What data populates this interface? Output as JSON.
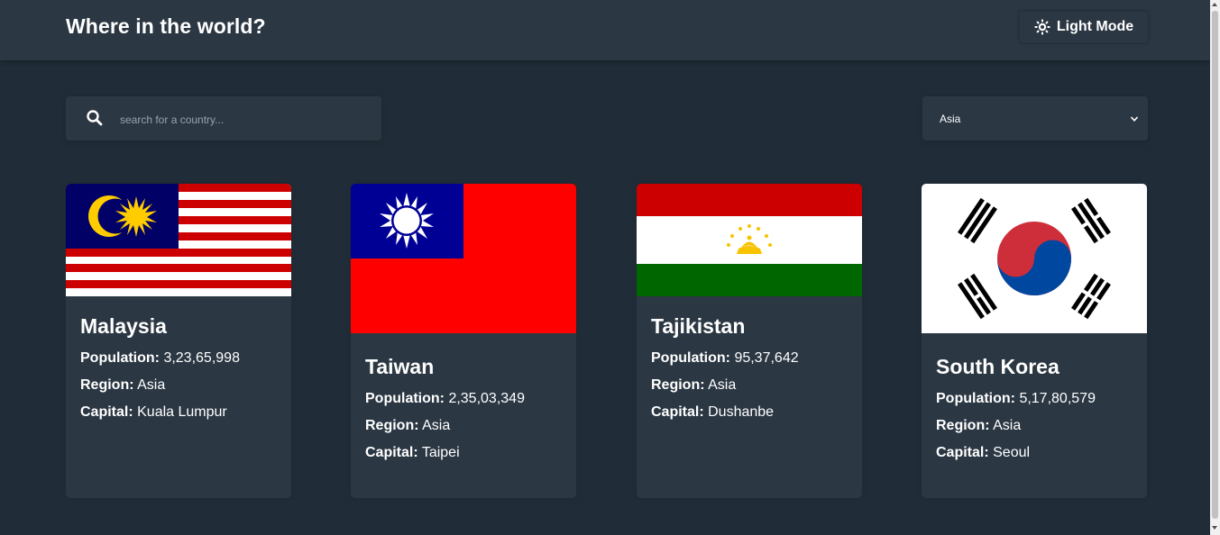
{
  "header": {
    "title": "Where in the world?",
    "theme_toggle_label": "Light Mode"
  },
  "search": {
    "placeholder": "search for a country...",
    "value": ""
  },
  "filter": {
    "selected": "Asia"
  },
  "labels": {
    "population": "Population:",
    "region": "Region:",
    "capital": "Capital:"
  },
  "countries": [
    {
      "name": "Malaysia",
      "population": "3,23,65,998",
      "region": "Asia",
      "capital": "Kuala Lumpur"
    },
    {
      "name": "Taiwan",
      "population": "2,35,03,349",
      "region": "Asia",
      "capital": "Taipei"
    },
    {
      "name": "Tajikistan",
      "population": "95,37,642",
      "region": "Asia",
      "capital": "Dushanbe"
    },
    {
      "name": "South Korea",
      "population": "5,17,80,579",
      "region": "Asia",
      "capital": "Seoul"
    }
  ],
  "colors": {
    "background": "#202c37",
    "element": "#2b3743",
    "text": "#ffffff"
  }
}
